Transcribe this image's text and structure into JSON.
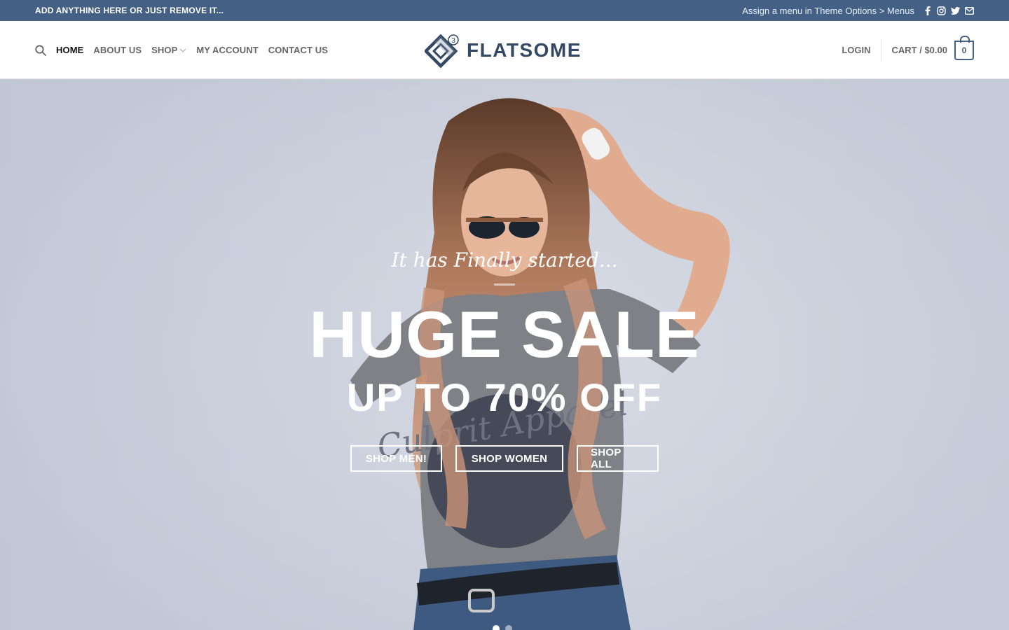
{
  "topbar": {
    "left_text": "ADD ANYTHING HERE OR JUST REMOVE IT...",
    "menu_hint": "Assign a menu in Theme Options > Menus",
    "social_icons": [
      "facebook-icon",
      "instagram-icon",
      "twitter-icon",
      "email-icon"
    ]
  },
  "header": {
    "nav": [
      {
        "label": "HOME",
        "active": true
      },
      {
        "label": "ABOUT US"
      },
      {
        "label": "SHOP",
        "has_dropdown": true
      },
      {
        "label": "MY ACCOUNT"
      },
      {
        "label": "CONTACT US"
      }
    ],
    "logo_text": "FLATSOME",
    "logo_badge": "3",
    "login_label": "LOGIN",
    "cart_label": "CART / $0.00",
    "cart_count": "0"
  },
  "hero": {
    "tagline": "It has Finally started...",
    "headline": "HUGE SALE",
    "subline": "UP TO 70% OFF",
    "buttons": [
      "SHOP MEN!",
      "SHOP WOMEN",
      "SHOP ALL"
    ],
    "tshirt_print": "Culprit Apparel"
  },
  "colors": {
    "primary": "#446084",
    "logo": "#334862",
    "hero_bg": "#d2d6e1"
  }
}
